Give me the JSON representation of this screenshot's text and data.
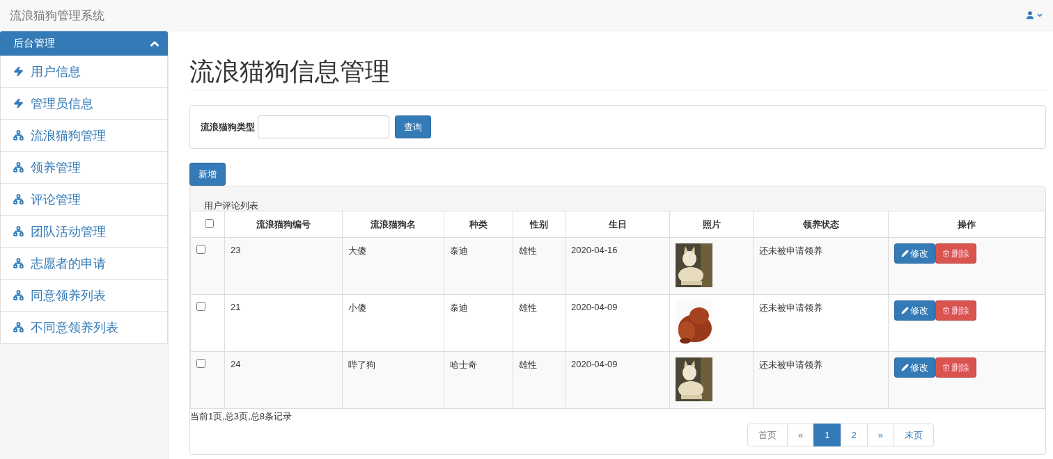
{
  "navbar": {
    "brand": "流浪猫狗管理系统"
  },
  "sidebar": {
    "title": "后台管理",
    "expanded": true,
    "items": [
      {
        "label": "用户信息",
        "kind": "bolt"
      },
      {
        "label": "管理员信息",
        "kind": "bolt"
      },
      {
        "label": "流浪猫狗管理",
        "kind": "sitemap"
      },
      {
        "label": "领养管理",
        "kind": "sitemap"
      },
      {
        "label": "评论管理",
        "kind": "sitemap"
      },
      {
        "label": "团队活动管理",
        "kind": "sitemap"
      },
      {
        "label": "志愿者的申请",
        "kind": "sitemap"
      },
      {
        "label": "同意领养列表",
        "kind": "sitemap"
      },
      {
        "label": "不同意领养列表",
        "kind": "sitemap"
      }
    ]
  },
  "page_title": "流浪猫狗信息管理",
  "search": {
    "label": "流浪猫狗类型",
    "button": "查询"
  },
  "add_button": "新增",
  "table": {
    "caption": "用户评论列表",
    "select_all_checked": false,
    "columns": [
      "流浪猫狗编号",
      "流浪猫狗名",
      "种类",
      "性别",
      "生日",
      "照片",
      "领养状态",
      "操作"
    ],
    "rows": [
      {
        "checked": false,
        "id": "23",
        "name": "大傻",
        "type": "泰迪",
        "sex": "雄性",
        "birthday": "2020-04-16",
        "status": "还未被申请领养",
        "edit": "修改",
        "delete": "删除"
      },
      {
        "checked": false,
        "id": "21",
        "name": "小傻",
        "type": "泰迪",
        "sex": "雄性",
        "birthday": "2020-04-09",
        "status": "还未被申请领养",
        "edit": "修改",
        "delete": "删除"
      },
      {
        "checked": false,
        "id": "24",
        "name": "哔了狗",
        "type": "哈士奇",
        "sex": "雄性",
        "birthday": "2020-04-09",
        "status": "还未被申请领养",
        "edit": "修改",
        "delete": "删除"
      }
    ]
  },
  "pager_info": "当前1页,总3页,总8条记录",
  "pagination": [
    {
      "label": "首页",
      "selected": false,
      "disabled": true
    },
    {
      "label": "«",
      "selected": false,
      "disabled": true
    },
    {
      "label": "1",
      "selected": true,
      "disabled": false
    },
    {
      "label": "2",
      "selected": false,
      "disabled": false
    },
    {
      "label": "»",
      "selected": false,
      "disabled": false
    },
    {
      "label": "末页",
      "selected": false,
      "disabled": false
    }
  ]
}
